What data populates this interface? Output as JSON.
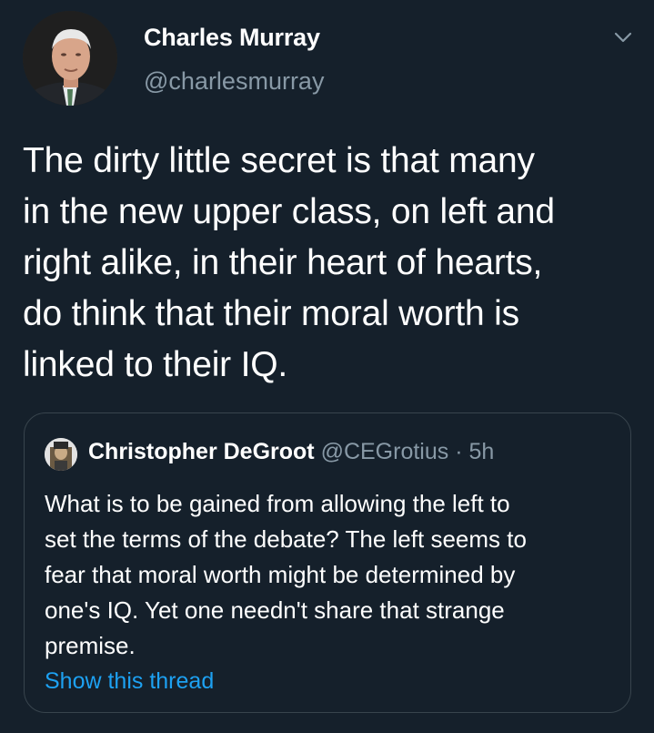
{
  "tweet": {
    "author": {
      "name": "Charles Murray",
      "handle": "@charlesmurray"
    },
    "text_lines": [
      "The dirty little secret is that many",
      "in the new upper class, on left and",
      "right alike, in their heart of hearts,",
      "do think that their moral worth is",
      "linked to their IQ."
    ],
    "menu_icon": "chevron-down-icon"
  },
  "quoted_tweet": {
    "author": {
      "name": "Christopher DeGroot",
      "handle": "@CEGrotius",
      "separator": "·",
      "time": "5h"
    },
    "text_lines": [
      "What is to be gained from allowing the left to",
      "set the terms of the debate? The left seems to",
      "fear that moral worth might be determined by",
      "one's IQ. Yet one needn't share that strange",
      "premise."
    ],
    "show_thread_label": "Show this thread"
  },
  "colors": {
    "background": "#15202b",
    "text": "#ffffff",
    "secondary_text": "#8899a6",
    "link": "#1da1f2",
    "border": "#38444d"
  }
}
